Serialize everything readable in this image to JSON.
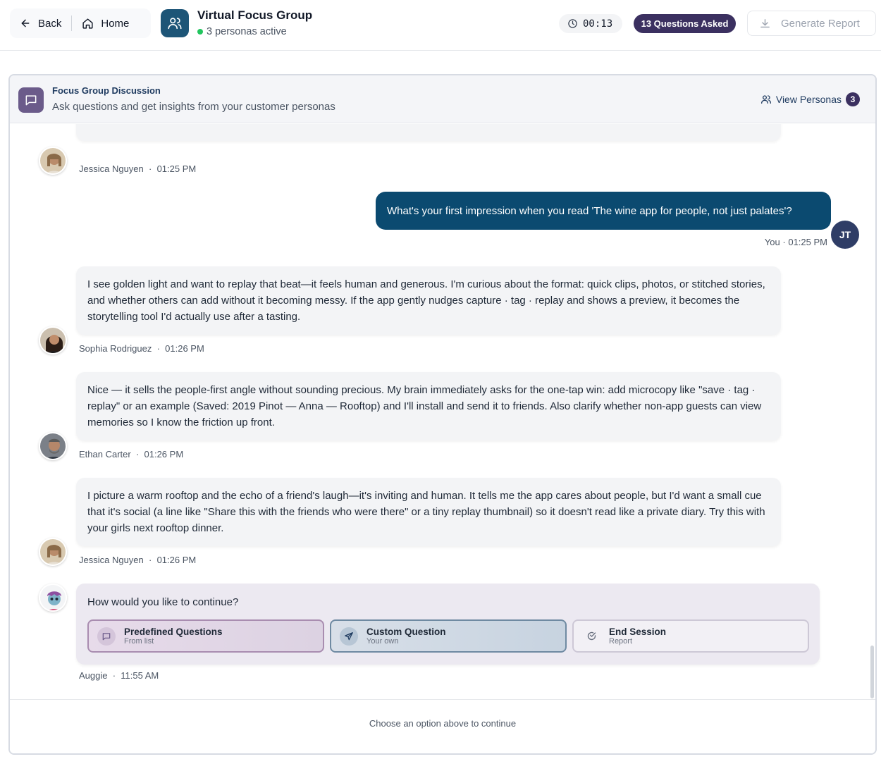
{
  "header": {
    "back_label": "Back",
    "home_label": "Home",
    "title": "Virtual Focus Group",
    "subtitle": "3 personas active",
    "timer": "00:13",
    "questions_badge": "13 Questions Asked",
    "generate_label": "Generate Report"
  },
  "panel": {
    "title": "Focus Group Discussion",
    "subtitle": "Ask questions and get insights from your customer personas",
    "view_personas_label": "View Personas",
    "persona_count": "3"
  },
  "messages": [
    {
      "author": "Jessica Nguyen",
      "time": "01:25 PM"
    },
    {
      "author": "You",
      "time": "01:25 PM",
      "initials": "JT",
      "text": "What's your first impression when you read 'The wine app for people, not just palates'?"
    },
    {
      "author": "Sophia Rodriguez",
      "time": "01:26 PM",
      "text": "I see golden light and want to replay that beat—it feels human and generous. I'm curious about the format: quick clips, photos, or stitched stories, and whether others can add without it becoming messy. If the app gently nudges capture · tag · replay and shows a preview, it becomes the storytelling tool I'd actually use after a tasting."
    },
    {
      "author": "Ethan Carter",
      "time": "01:26 PM",
      "text": "Nice — it sells the people-first angle without sounding precious. My brain immediately asks for the one-tap win: add microcopy like \"save · tag · replay\" or an example (Saved: 2019 Pinot — Anna — Rooftop) and I'll install and send it to friends. Also clarify whether non-app guests can view memories so I know the friction up front."
    },
    {
      "author": "Jessica Nguyen",
      "time": "01:26 PM",
      "text": "I picture a warm rooftop and the echo of a friend's laugh—it's inviting and human. It tells me the app cares about people, but I'd want a small cue that it's social (a line like \"Share this with the friends who were there\" or a tiny replay thumbnail) so it doesn't read like a private diary. Try this with your girls next rooftop dinner."
    }
  ],
  "continue": {
    "question": "How would you like to continue?",
    "author": "Auggie",
    "time": "11:55 AM",
    "options": [
      {
        "title": "Predefined Questions",
        "sub": "From list"
      },
      {
        "title": "Custom Question",
        "sub": "Your own"
      },
      {
        "title": "End Session",
        "sub": "Report"
      }
    ]
  },
  "footer": {
    "hint": "Choose an option above to continue"
  },
  "colors": {
    "primary": "#0b4a70",
    "badge": "#3b3060",
    "online": "#22c55e"
  }
}
